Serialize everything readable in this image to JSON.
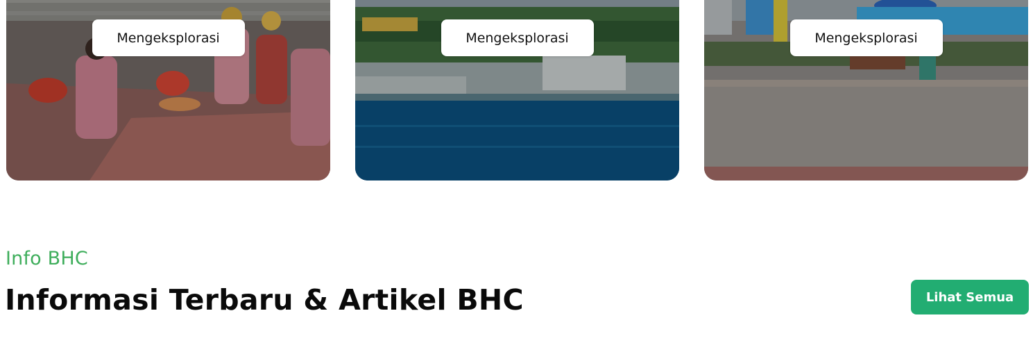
{
  "destinations": {
    "cards": [
      {
        "button_label": "Mengeksplorasi",
        "image": "traditional-dance-photo"
      },
      {
        "button_label": "Mengeksplorasi",
        "image": "waterfront-city-photo"
      },
      {
        "button_label": "Mengeksplorasi",
        "image": "waterpark-pool-photo"
      }
    ]
  },
  "info_section": {
    "eyebrow": "Info BHC",
    "title": "Informasi Terbaru & Artikel BHC",
    "see_all_label": "Lihat Semua"
  },
  "colors": {
    "eyebrow": "#3fae5c",
    "see_all_bg": "#22ad72",
    "heading": "#0a0a0a"
  }
}
